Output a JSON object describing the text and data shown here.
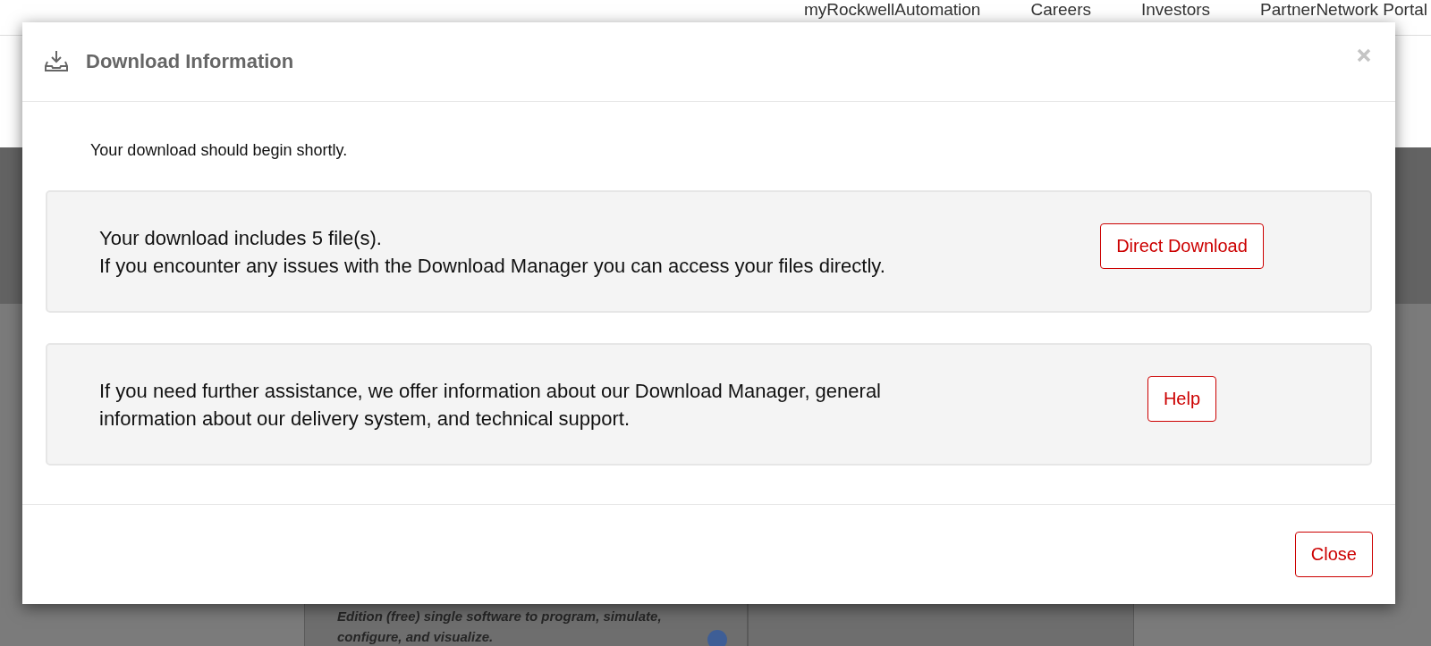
{
  "top_nav": {
    "links": [
      "myRockwellAutomation",
      "Careers",
      "Investors",
      "PartnerNetwork Portal"
    ]
  },
  "background_card": {
    "text": "Edition (free) single software to program, simulate, configure, and visualize."
  },
  "modal": {
    "title": "Download Information",
    "intro": "Your download should begin shortly.",
    "panels": [
      {
        "lines": [
          "Your download includes 5 file(s).",
          "If you encounter any issues with the Download Manager you can access your files directly."
        ],
        "button": "Direct Download"
      },
      {
        "lines": [
          "If you need further assistance, we offer information about our Download Manager, general",
          "information about our delivery system, and technical support."
        ],
        "button": "Help"
      }
    ],
    "close_button": "Close"
  }
}
